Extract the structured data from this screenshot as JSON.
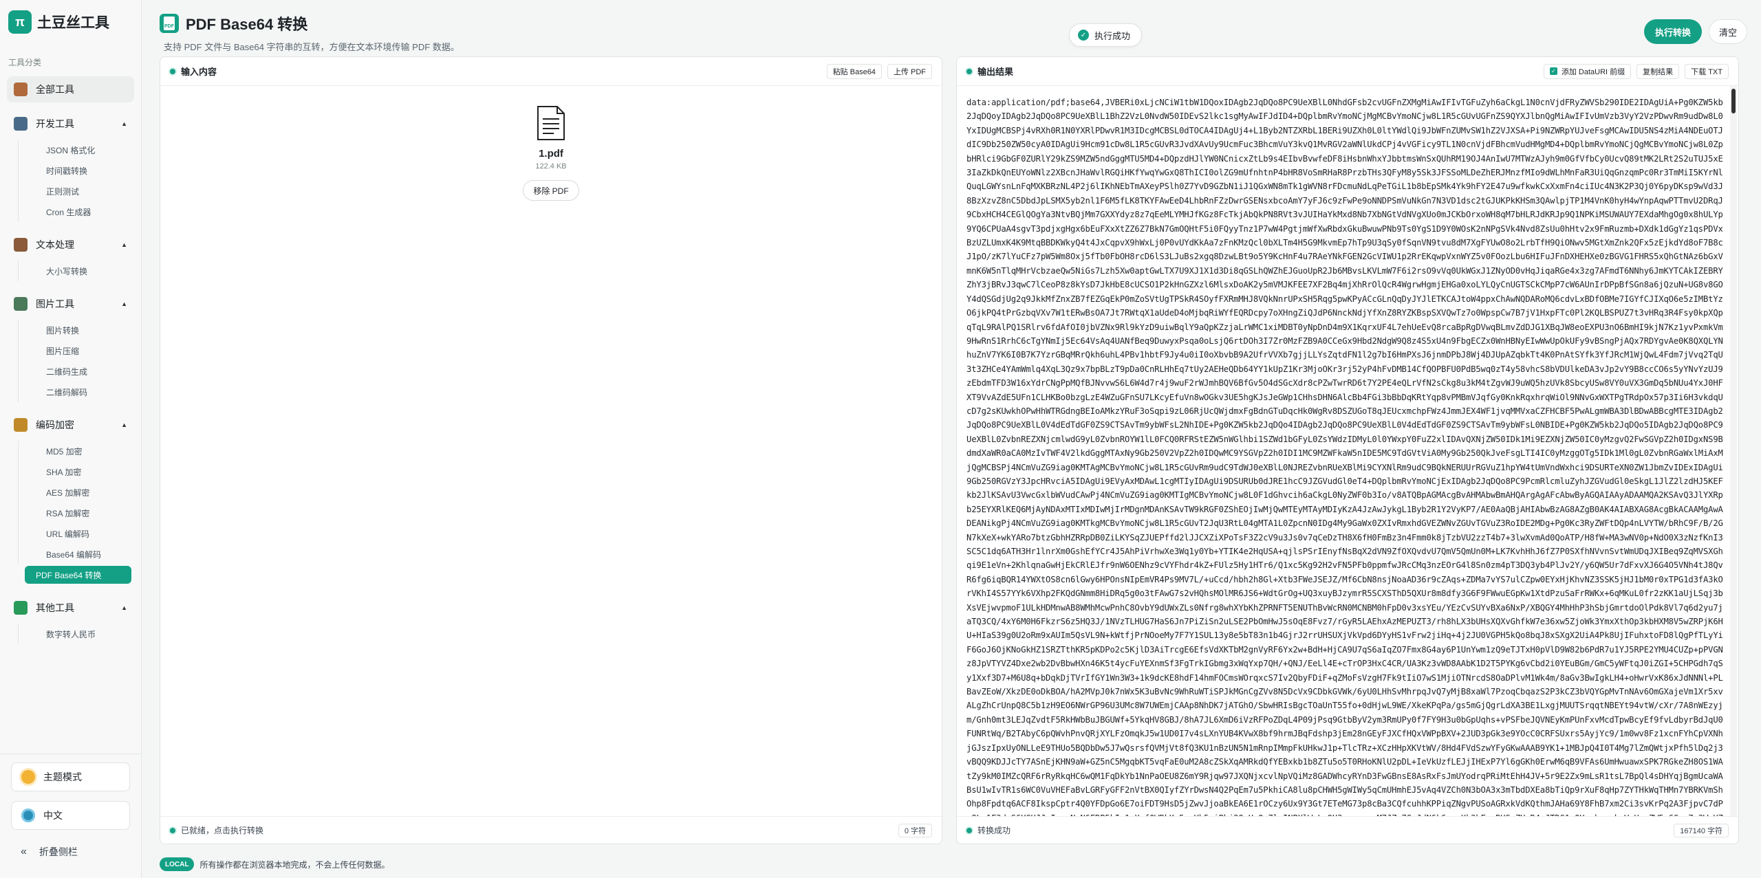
{
  "brand": {
    "name": "土豆丝工具",
    "logo_glyph": "π"
  },
  "sidebar": {
    "section_label": "工具分类",
    "groups": [
      {
        "label": "全部工具",
        "icon": "book-icon",
        "color": "#b06a3b",
        "items": []
      },
      {
        "label": "开发工具",
        "icon": "laptop-icon",
        "color": "#4a6a8a",
        "items": [
          "JSON 格式化",
          "时间戳转换",
          "正则测试",
          "Cron 生成器"
        ]
      },
      {
        "label": "文本处理",
        "icon": "notebook-icon",
        "color": "#8a5a3a",
        "items": [
          "大小写转换"
        ]
      },
      {
        "label": "图片工具",
        "icon": "picture-icon",
        "color": "#4a7a5a",
        "items": [
          "图片转换",
          "图片压缩",
          "二维码生成",
          "二维码解码"
        ]
      },
      {
        "label": "编码加密",
        "icon": "lock-icon",
        "color": "#c08a2a",
        "items": [
          "MD5 加密",
          "SHA 加密",
          "AES 加解密",
          "RSA 加解密",
          "URL 编解码",
          "Base64 编解码",
          "PDF Base64 转换"
        ]
      },
      {
        "label": "其他工具",
        "icon": "puzzle-icon",
        "color": "#2a9a5a",
        "items": [
          "数字转人民币"
        ]
      }
    ],
    "active_item": "PDF Base64 转换",
    "theme_label": "主题模式",
    "lang_label": "中文",
    "collapse_label": "折叠侧栏"
  },
  "header": {
    "title": "PDF Base64 转换",
    "subtitle": "支持 PDF 文件与 Base64 字符串的互转，方便在文本环境传输 PDF 数据。",
    "toast": "执行成功",
    "run_label": "执行转换",
    "clear_label": "清空"
  },
  "input_panel": {
    "title": "输入内容",
    "paste_label": "粘贴 Base64",
    "upload_label": "上传 PDF",
    "file_name": "1.pdf",
    "file_size": "122.4 KB",
    "remove_label": "移除 PDF",
    "status": "已就绪，点击执行转换",
    "count": "0 字符"
  },
  "output_panel": {
    "title": "输出结果",
    "datauri_label": "添加 DataURI 前缀",
    "copy_label": "复制结果",
    "download_label": "下载 TXT",
    "status": "转换成功",
    "count": "167140 字符",
    "content": "data:application/pdf;base64,JVBERi0xLjcNCiW1tbW1DQoxIDAgb2JqDQo8PC9UeXBlL0NhdGFsb2cvUGFnZXMgMiAwIFIvTGFuZyh6aCkgL1N0cnVjdFRyZWVSb290IDE2IDAgUiA+Pg0KZW5kb2JqDQoyIDAgb2JqDQo8PC9UeXBlL1BhZ2VzL0NvdW50IDEvS2lkc1sgMyAwIFJdID4+DQplbmRvYmoNCjMgMCBvYmoNCjw8L1R5cGUvUGFnZS9QYXJlbnQgMiAwIFIvUmVzb3VyY2VzPDwvRm9udDw8L0YxIDUgMCBSPj4vRXh0R1N0YXRlPDwvR1M3IDcgMCBSL0dTOCA4IDAgUj4+L1Byb2NTZXRbL1BERi9UZXh0L0ltYWdlQi9JbWFnZUMvSW1hZ2VJXSA+Pi9NZWRpYUJveFsgMCAwIDU5NS4zMiA4NDEuOTJdIC9Db250ZW50cyA0IDAgUi9Hcm91cDw8L1R5cGUvR3JvdXAvUy9UcmFuc3BhcmVuY3kvQ1MvRGV2aWNlUkdCPj4vVGFicy9TL1N0cnVjdFBhcmVudHMgMD4+DQplbmRvYmoNCjQgMCBvYmoNCjw8L0ZpbHRlci9GbGF0ZURlY29kZS9MZW5ndGggMTU5MD4+DQpzdHJlYW0NCnicxZtLb9s4EIbvBvwfeDF8iHsbnWhxYJbbtmsWnSxQUhRM19OJ4AnIwU7MTWzAJyh9m0GfVfbCy0UcvQ89tMK2LRt2S2uTUJ5xE3IaZkDkQnEUYoWNlz2XBcnJHaWvlRGQiHKfYwqYwGxQ8ThICI0olZG9mUfnhtnP4bHR8VoSmRHaR8PrzbTHs3QFyM8y5Sk3JFSSoMLDeZhERJMnzfMIo9dWLhMnFaR3UiQqGnzqmPc0Rr3TmMiI5KYrNlQuqLGWYsnLnFqMXKBRzNL4P2j6lIKhNEbTmAXeyPSlh0Z7YvD9GZbN1iJ1QGxWN8mTk1gWVN8rFDcmuNdLqPeTGiL1b8bEpSMk4Yk9hFY2E47u9wfkwkCxXxmFn4ciIUc4N3K2P3Qj0Y6pyDKsp9wVd3J8BzXzvZ8nC5DbdJpLSMX5yb2nl1F6M5fLK8TKYFAwEeD4LhbRnFZzDwrGSENsxbcoAmY7yFJ6c9zFwPe9oNNDPSmVuNkGn7N3VD1dsc2tGJUKPkKHSm3QAwlpjTP1M4VnK0hyH4wYnpAqwPTTmvU2DRqJ9CbxHCH4CEGlQOgYa3NtvBQjMm7GXXYdyz8z7qEeMLYMHJfKGz8FcTkjAbQkPN8RVt3vJUIHaYkMxd8Nb7XbNGtVdNVgXUo0mJCKbOrxoWH8qM7bHLRJdKRJp9Q1NPKiMSUWAUY7EXdaMhgOg0x8hULYp9YQ6CPUaA4sgvT3pdjxgHgx6bEuFXxXtZZ6Z7BkN7GmOQHtF5i0FQyyTnz1P7wW4PgtjmWfXwRbdxGkuBwuwPNb9Ts0YgS1D9Y0WOsK2nNPgSVk4Nvd8ZsUu0hHtv2x9FmRuzmb+DXdk1dGgYz1qsPDVxBzUZLUmxK4K9MtqBBDKWkyQ4t4JxCqpvX9hWxLj0P0vUYdKkAa7zFnKMzQcl0bXLTm4H5G9MkvmEp7hTp9U3qSy0fSqnVN9tvu8dM7XgFYUwO8o2LrbTfH9QiONwv5MGtXmZnk2QFx5zEjkdYd8oF7B8cJ1pO/zK7lYuCFz7pW5Wm8Oxj5fTb0FbOH8rcD6lS3LJuBs2xgq8DzwLBt9o5Y9KcHnF4u7RAeYNkFGEN2GcVIWU1p2RrEKqwpVxnWYZ5v0FOozLbu6HIFuJFnDXHEHXe0zBGVG1FHRS5xQhGtNAz6bGxVmnK6W5nTlqMHrVcbzaeQw5NiGs7Lzh5Xw0aptGwLTX7U9XJ1X1d3Di8qGSLhQWZhEJGuoUpR2Jb6MBvsLKVLmW7F6i2rsO9vVq0UkWGxJ1ZNyOD0vHqJiqaRGe4x3zg7AFmdT6NNhy6JmKYTCAkIZEBRYZhY3jBRvJ3qwC7lCeoP8z8kYsD7JkHbE8cUCSO1P2kHnGZXzl6MlsxDoAK2y5mVMJKFEE7XF2Bq4mjXhRrOlQcR4WgrwHgmjEHGa0xoLYLQyCnUGTSCkCMpP7cW6AUnIrDPpBfSGn8a6jQzuN+UG8v8GOY4dQSGdjUg2q9JkkMfZnxZB7fEZGqEkP0mZoSVtUgTPSkR4SOyfFXRmMHJ8VQkNnrUPxSH5Rqg5pwKPyACcGLnQqDyJYJlETKCAJtoW4ppxChAwNQDARoMQ6cdvLxBDfOBMe7IGYfCJIXqO6e5zIMBtYzO6jkPQ4tPrGzbqVXv7W1tERwBsOA7Jt7RWtqX1aUdeD4oMjbqRiWYfEQRDcpy7oXHngZiQJdP6NnckNdjYfXnZ8RYZKBspSXVQwTz7o0WpspCw7B7jV1HxpFTc0Pl2KQLBSPUZ7t3vHRq3R4Fsy0kpXQpqTqL9RAlPQ1SRlrv6fdAfOI0jbVZNx9Rl9kYzD9uiwBqlY9aQpKZzjaLrWMC1xiMDBT0yNpDnD4m9X1KqrxUF4L7ehUeEvQ8rcaBpRgDVwqBLmvZdDJG1XBqJW8eoEXPU3nO6BmHI9kjN7Kz1yvPxmkVm9HwRnS1RrhC6cTgYNmIj5Ec64VsAq4UANfBeq9DuwyxPsqa0oLsjQ6rtDOh3I7Zr0MzFZB9A0CCeGx9Hbd2NdgW9Q8z4S5xU4n9FbgECZx0WnHBNyEIwWwUpOkUFy9vBSngPjAQx7RDYgvAe0K8QXQLYNhuZnV7YK6I0B7K7YzrGBqMRrQkh6uhL4PBv1hbtF9Jy4u0iI0oXbvbB9A2UfrVVXb7gjjLLYsZqtdFN1l2g7bI6HmPXsJ6jnmDPbJ8Wj4DJUpAZqbkTt4K0PnAtSYfk3YfJRcM1WjQwL4Fdm7jVvq2TqU3t3ZHCe4YAmWmlq4XqL3Qz9x7bpBLzT9pDa0CnRLHhEq7tUy2AEHeQDb64YY1kUpZ1Kr3MjoOKr3rj52yP4hFvDMB14CfQOPBFU0PdB5wq0zT4y58vhcS8bVDUlkeDA3vJp2vY9B8ccCO6s5yYNvYzUJ9zEbdmTFD3W16xYdrCNgPpMQfBJNvvwS6L6W4d7r4j9wuF2rWJmhBQV6BfGv5O4dSGcXdr8cPZwTwrRD6t7Y2PE4eQLrVfN2sCkg8u3kM4tZgvWJ9uWQ5hzUVk8SbcyUSw8VY0uVX3GmDq5bNUu4YxJ0HFXT9VvAZdE5UFn1CLHKBo0bzgLzE4WZuGFnSU7LKcyEfuVn8wOGkv3UE5hgKJsJeGWp1CHhsDHN6AlcBb4FGi3bBbDqKRtYqp8vPMBmVJqfGy0KnkRqxhrqWiOl9NNvGxWXTPgTRdpOx57p3Ii6H3vkdqUcD7g2sKUwkhOPwHhWTRGdngBEIoAMkzYRuF3oSqpi9zL06RjUcQWjdmxFgBdnGTuDqcHk0WgRv8DSZUGoT8qJEUcxmchpFWz4JmmJEX4WF1jvqMMVxaCZFHCBF5PwALgmWBA3DlBDwABBcgMTE3IDAgb2JqDQo8PC9UeXBlL0V4dEdTdGF0ZS9CTSAvTm9ybWFsL2NhIDE+Pg0KZW5kb2JqDQo4IDAgb2JqDQo8PC9UeXBlL0V4dEdTdGF0ZS9CTSAvTm9ybWFsL0NBIDE+Pg0KZW5kb2JqDQo5IDAgb2JqDQo8PC9UeXBlL0ZvbnREZXNjcmlwdG9yL0ZvbnROYW1lL0FCQ0RFRStEZW5nWGlhbi1SZWd1bGFyL0ZsYWdzIDMyL0l0YWxpY0FuZ2xlIDAvQXNjZW50IDk1Mi9EZXNjZW50IC0yMzgvQ2FwSGVpZ2h0IDgxNS9BdmdXaWR0aCA0MzIvTWF4V2lkdGggMTAxNy9Gb250V2VpZ2h0IDQwMC9YSGVpZ2h0IDI1MC9MZWFkaW5nIDE5MC9TdGVtViA0My9Gb250QkJveFsgLTI4IC0yMzggOTg5IDk1Ml0gL0ZvbnRGaWxlMiAxMjQgMCBSPj4NCmVuZG9iag0KMTAgMCBvYmoNCjw8L1R5cGUvRm9udC9TdWJ0eXBlL0NJREZvbnRUeXBlMi9CYXNlRm9udC9BQkNERUUrRGVuZ1hpYW4tUmVndWxhci9DSURTeXN0ZW1JbmZvIDExIDAgUi9Gb250RGVzY3JpcHRvciA5IDAgUi9EVyAxMDAwL1cgMTIyIDAgUi9DSURUb0dJRE1hcC9JZGVudGl0eT4+DQplbmRvYmoNCjExIDAgb2JqDQo8PC9PcmRlcmluZyhJZGVudGl0eSkgL1JlZ2lzdHJ5KEFkb2JlKSAvU3VwcGxlbWVudCAwPj4NCmVuZG9iag0KMTIgMCBvYmoNCjw8L0F1dGhvcih6aCkgL0NyZWF0b3Io/v8ATQBpAGMAcgBvAHMAbwBmAHQArgAgAFcAbwByAGQAIAAyADAAMQA2KSAvQ3JlYXRpb25EYXRlKEQ6MjAyNDAxMTIxMDIwMjIrMDgnMDAnKSAvTW9kRGF0ZShEOjIwMjQwMTEyMTAyMDIyKzA4JzAwJykgL1Byb2R1Y2VyKP7/AE0AaQBjAHIAbwBzAG8AZgB0AK4AIABXAG8AcgBkACAAMgAwADEANikgPj4NCmVuZG9iag0KMTkgMCBvYmoNCjw8L1R5cGUvT2JqU3RtL04gMTA1L0ZpcnN0IDg4My9GaWx0ZXIvRmxhdGVEZWNvZGUvTGVuZ3RoIDE2MDg+Pg0Kc3RyZWFtDQp4nLVYTW/bRhC9F/B/2GN7kXeX+wkYARo7btzGbhHZRRpDB0ZiLKYSqZJUEPffd2lJJCXZiXPoTsF3Z2cV9u3Js0v7qCeDzTH8X6fH0FmBz3n4Fmm0k8jTzbVU2zzT4b7+3lwXvmAd0QoATP/H8fW+MA3wNV0p+NdO0X3zNzfKnI3SC5C1dq6ATH3Hr1lnrXm0GshEfYCr4J5AhPiVrhwXe3Wq1y0Yb+YTIK4e2HqUSA+qjlsPSrIEnyfNsBqX2dVN9ZfOXQvdvU7QmV5QmUn0M+LK7KvhHhJ6fZ7P0SXfhNVvnSvtWmUDqJXIBeq9ZqMVSXGhqi9E1eVn+2KhlqnaGwHjEkCRlEJfr9nW6OENhz9cVYFhdr4kZ+FUlz5Hy1HTr6/Q1xc5Kg92H2vFN5PFb0ppmfwJRcCMq3nzEOrG4l8Sn0zm4pT3DQ3yb4PlJv2Y/y6QW5Ur7dFxvXJ6G4O5VNh4tJ8QvR6fg6iqBQR14YWXtOS8cn6lGwy6HPOnsNIpEmVR4Ps9MV7L/+uCcd/hbh2h8Gl+Xtb3FWeJSEJZ/Mf6CbN8nsjNoaAD36r9cZAqs+ZDMa7vYS7ulCZpw0EYxHjKhvNZ3SSK5jHJ1bM0r0xTPG1d3fA3kOrVKhI4S57YYk6VXhp2FKQdGNmm8HiDRq5g0o3tFAwG7s2vHQhsMOlMR6JS6+WdtGrOg+UQ3xuyBJzymrR5SCXSThD5QXUr8m8dfy3G6F9FWwuEGpKw1XtdPzuSaFrRWKx+6qMKuL0fr2zKK1aUjLSqj3bXsVEjwvpmoF1ULkHDMnwAB8WMhMcwPnhC8OvbY9dUWxZLs0Nfrg8whXYbKhZPRNFT5ENUThBvWcRN0MCNBM0hFpD0v3xsYEu/YEzCvSUYvBXa6NxP/XBQGY4MhHhP3hSbjGmrtdoOlPdk8Vl7q6d2yu7jaTQ3CQ/4xY6M0H6FkzrS6z5HQ3J/1NVzTLHUG7HaS6Jn7PiZiSn2uLSE2PbOmHwJ5sOqE8Fvz7/rGyR5LAEhxAzMEPUZT3/rh8hLX3bUHsXQXvGhfkW7e36xw5ZjoWk3YmxXthOp3kbHXM8V5wZRPjK6HU+HIaS39g0U2oRm9xAUIm5QsVL9N+kWtfjPrNOoeMy7F7Y1SUL13y8e5bT83n1b4GjrJ2rrUHSUXjVkVpd6DYyHS1vFrw2jiHq+4j2JU0VGPH5kQo8bqJ8xSXgX2UiA4Pk8UjIFuhxtoFD8lQgPfTLyYiF6GoJ6OjKNoGkHZ1SRZTthKR5pKDPo2c5KjlD3AiTrcgE6EfsVdXKTbM2gnVyRF6Yx2w+BdH+HjCA9U7qS6aIqZO7Fmx8G4ay6P1UnYwm1zQ9eTJTxH0pVlD9W82b6PdR7u1YJ5RPE2YMU4CUZp+pPVGNz8JpVTYVZ4Dxe2wb2DvBbwHXn46K5t4ycFuYEXnmSf3FgTrkIGbmg3xWqYxp7QH/+QNJ/EeLl4E+cTrOP3HxC4CR/UA3Kz3vWD8AAbK1D2T5PYKg6vCbd2i0YEuBGm/GmC5yWFtqJ0iZGI+5CHPGdh7qSy1Xxf3D7+M6U8q+bDqkDjTVrIfGY1Wn3W3+1k9dcKE8hdF14hmFOCmsWOrqxcS7Iv2QbyFDiF+qZMoFsVzgH7Fk9tIiO7wS1MjiOTNrcdS8OaDPlvM1Wk4m/8aGv3BwIgkLH4+oHwrVxK86xJdNNNl+PLBavZEoW/XkzDE0oDkBOA/hA2MVpJ0k7nWx5K3uBvNc9WhRuWTiSPJkMGnCgZVv8N5DcVx9CDbkGVWk/6yU0LHhSvMhrpqJvQ7yMjB8xaWl7PzoqCbqazS2P3kCZ3bVQYGpMvTnNAv6OmGXajeVm1Xr5xvALgZhCrUnpQ8C5b1zH9EO6NWrGP96U3UMc8W7UWEmjCAAp8NhDK7jATGhO/SbwHRIsBgcTOaUnT55fo+0dHjwL9WE/XkeKPqPa/gs5mGjQgrLdXA3BE1LxgjMUUTSrqqtNBEYt94vtW/cXr/7A8nWEzyjm/Gnh0mt3LEJqZvdtF5RkHWbBuJBGUWf+5YkqHV8GBJ/8hA7JL6XmD6iVzRFPoZDqL4P09jPsq9GtbByV2ym3RmUPy0f7FY9H3u0bGpUqhs+vPSFbeJQVNEyKmPUnFxvMcdTpwBcyEf9fvLdbyrBdJqU0FUNRtWq/B2TAbyC6pQWvhPnvQRjXYLFzOmqkJ5w1UD0I7v4sLXnYUB4KVwX8bf9hrmJBqFdshp3jEm28nGEyFJXCfHQxVWPpBXV+2JUD3pGk3e9YOcC0CRFSUxrs5AyjYc9/1m0wv8Fz1xcnFYhCpVXNhjGJszIpxUyONLLeE9THUo5BQDbDw5J7wQsrsfQVMjVt8fQ3KU1nBzUN5N1mRnpIMmpFkUHkwJ1p+TlcTRz+XCzHHpXKVtWV/8Hd4FVdSzwYFyGKwAAAB9YK1+1MBJpQ4I0T4Mg7lZmQWtjxPfh5lDq2j3vBQQ9KDJJcTY7ASnEjKHN9aW+GZ5nC5MgqbKT5vqFaE0uM2A8cZSkXqAMRkdQfYEBxkb1b8ZTu5o5T0RHoKNlU2pDL+IeVkUzfLEJjIHExP7Yl6gGKh0ErwM6qB9VFAs6UmHwuawxSPK7RGkeZH8OS1WAtZy9kM0IMZcQRF6rRyRkqHC6wQM1FqDkYb1NnPaOEU8Z6mY9Rjqw97JXQNjxcvlNpVQiMz8GADWhcyRYnD3FwGBnsE8AsRxFsJmUYodrqPRiMtEhH4JV+5r9E2Zx9mLsR1tsL7BpQl4sDHYqjBgmUcaWABsU1wIvTR1s6WC0VuVHEFaBvLGRFyGFF2nVtBX0QIyfZYrDwsN4Q2PqEm7u5PkhiCA8lu8pCHWH5gWIWy5qCmUHmhEJ5vAq4VZCh0N3bOA3x3mTbdDXEa8bTiQp9rXuF8qHp7ZYTHkWqTHMn7YBRKVmShOhp8Fpdtq6ACF8IkspCptr4Q0YFDpGo6E7oiFDT9HsD5jZwvJjoaBkEA6E1rOCzy6Ux9Y3Gt7ETeMG73p8cBa3CQfcuhhKPPiqZNgvPUSoAGRxkVdKQthmJAHa69Y8FhB7xm2Ci3svKrPq2A3FjpvC7dPg8Lr1F3dxS6YGUJJaIxaqNgN6FRP5kIw1nXqf0WBkKp5mzYb5oiPbj2QqUsOc7lyINPXlWqLe9U3eqqgyyuM7JZu7GxJdN6k6nvoXk3hF+wRUSqZHyR4mJTDG1mOUcpkxsckpVoHxyZW5r6Grn7a3WpHZNaFqjqXr9Mt6rlDdm8eXdbMWRVs2M1JA2RN7Di3rh0uSX8yRpHAHqgXXcdnFawqSqm1mUSMz5tLjQN+3LCEbANohSLrXkf1EhbUDTixgB6N48Nt2ehQZrVo5OlZVXEJ7l8nXuYiXVuYdpO4OcsUnN7SzPWDuUNlYCuVmGqOBFBnZjQmF6GbEUvEpNE3FVnjhGWz1c7D0lYi85tpy7ueS1EDqrRVDE4QbXF8PXrdnIbFOdzObR2HWnY8K4QSpRHfsExRGx1gV0j0Zb8IIbm2DByxyS2VtUm7B8Fq1wH9ihwTMdTGi2ZOBtBvDbxoVB5LyBHJcDpvSyVjS5aZMXHXr5cVh2KsS2g0BgrHaRN7ViCvlVqkGl6q5xxEjPQ6o6wvNsvzr1BMeFVcVBOGd31Zqtnc7MtK6MMBnZ2KBXnvNsG4bJfD8y4TPB1bDj3fNRUh+x3Vcs1pPWxA3jGJVFaeJXf0vMYsd8o6rZ9GEVGYV4B2AzHcLbmnZ5yA7eVG5aG3NoPqJbYWyr9nMuv7Vkt8xvoDk5ETIzQ8c6J3IGhV9RPOnbG+sG8qvsJ2i4bj1RS7xTJtdcAjvbDAzVTp2Kc2dUbVn9qSDh5nFmZ4Z0W8OQlxs5ThFD7JGxG0WoJuxLRCb7XrmvZ6NjD7V8LAVbtDyPnSycD7NhPhVr9A5zE8LUx4mDaKTPjm6Uqdkd5V3YVqVqDYv3hk1QEaUfmWX9Cc0e3j6wJ7bqUzy1tWDvAeNQt8rLl3LNFhQwaS5LCZzJaUWDAHT8ET0g8dnvNVVT7kJU3ufB0DHq9SPQ1lUKfWb8fe1qkc0SqAMJCVGeS8VBRIkhq3zqBbyxjNAjvdrNbmRJN0U8vkOCNOKYUCahvKmySrsSZmFBCUyNqsS0vNr0kYXcwW1zjvJE2lTBxI9D5ouGYUT3JfnbhgJCi0TNYcDRfOpLDJJc8bvJCUEM0KRF7Mdq2hH5bkD3dGVC0DyVgJYNq5lX0eMMyTzUHX3fLHdWUJcYoHzQmb9H1AMCevMXLNDcDA1VpAHDnfBUA1ziyCNUdjS2XHVCfeVGU2I8IZ2p8Q0x7JhQKhm8jvKdsC3EQZdoy7wKMYWULJF4qWz8QcW2Wuwx1N1q7xJjkLbGZu6FIkqWpxq3EU8fJYLJHc6K3fGKEgvYtvcFYOGfT1Y8kNHzEYYEDnFvmaXlvdd7Bs7GKKbU9vQNTzjxlDEXgn6GPj7vfHsNEdBrCzcqIG2DoZmJUrnrWeTAWtnQt7tiNHkNJ0cznRq1LBNB1KmnnCFNnPS1ZOzLMFvNwN3tZX2NuNWYwfGEBm5lZ3KBcsl8x0ZMZbVLPQJP7DwyggdD2sZlf5uvX0yCfmfLBpfAkdGpH8TL8BzxQ1g0YaZXyVZ3lAEYHS"
  },
  "footer": {
    "badge": "LOCAL",
    "note": "所有操作都在浏览器本地完成，不会上传任何数据。"
  },
  "colors": {
    "accent": "#14a085"
  }
}
